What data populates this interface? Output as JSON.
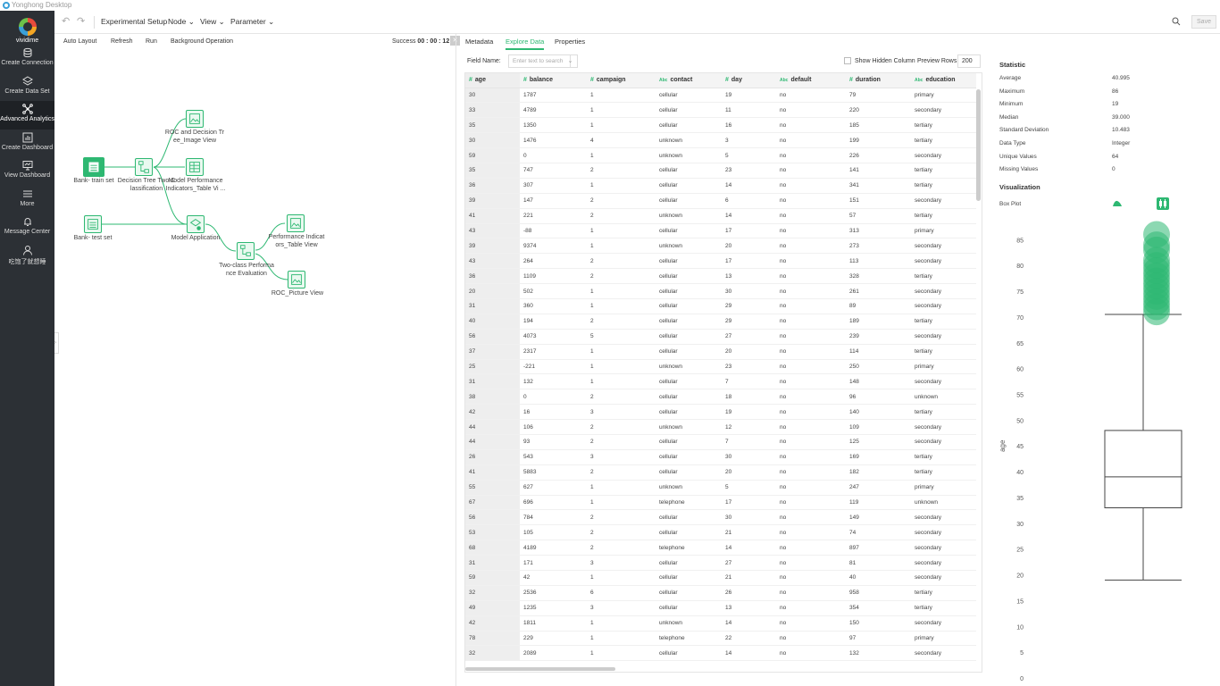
{
  "window_title": "Yonghong Desktop",
  "brand": "vividime",
  "sidebar": {
    "items": [
      {
        "label": "Create Connection",
        "icon": "database-icon"
      },
      {
        "label": "Create Data Set",
        "icon": "layers-icon"
      },
      {
        "label": "Advanced Analytics",
        "icon": "network-icon",
        "active": true
      },
      {
        "label": "Create Dashboard",
        "icon": "bar-chart-icon"
      },
      {
        "label": "View Dashboard",
        "icon": "monitor-icon"
      },
      {
        "label": "More",
        "icon": "menu-icon"
      },
      {
        "label": "Message Center",
        "icon": "bell-icon"
      },
      {
        "label": "吃饱了就想睡",
        "icon": "user-icon"
      }
    ]
  },
  "toolbar": {
    "title": "Experimental Setup",
    "node_menu": "Node",
    "view_menu": "View",
    "parameter_menu": "Parameter",
    "save_label": "Save"
  },
  "canvas_toolbar": {
    "auto_layout": "Auto Layout",
    "refresh": "Refresh",
    "run": "Run",
    "background": "Background Operation",
    "success_label": "Success",
    "success_time": "00 : 00 : 12"
  },
  "flow_nodes": {
    "train": "Bank- train set",
    "test": "Bank- test set",
    "dt_l1": "Decision Tree Two C",
    "dt_l2": "lassification",
    "roc_img_l1": "ROC and Decision Tr",
    "roc_img_l2": "ee_Image View",
    "mpi_l1": "Model Performance",
    "mpi_l2": "Indicators_Table Vi ...",
    "apply": "Model Application",
    "eval_l1": "Two-class Performa",
    "eval_l2": "nce Evaluation",
    "perf_l1": "Performance Indicat",
    "perf_l2": "ors_Table View",
    "roc_pic": "ROC_Picture View"
  },
  "tabs": {
    "metadata": "Metadata",
    "explore": "Explore Data",
    "properties": "Properties"
  },
  "filter": {
    "field_name_label": "Field Name:",
    "field_placeholder": "Enter text to search",
    "show_hidden": "Show Hidden Column",
    "preview_rows_label": "Preview Rows",
    "preview_rows": "200"
  },
  "table": {
    "columns": [
      {
        "name": "age",
        "type": "#"
      },
      {
        "name": "balance",
        "type": "#"
      },
      {
        "name": "campaign",
        "type": "#"
      },
      {
        "name": "contact",
        "type": "Abc"
      },
      {
        "name": "day",
        "type": "#"
      },
      {
        "name": "default",
        "type": "Abc"
      },
      {
        "name": "duration",
        "type": "#"
      },
      {
        "name": "education",
        "type": "Abc"
      }
    ],
    "rows": [
      [
        "30",
        "1787",
        "1",
        "cellular",
        "19",
        "no",
        "79",
        "primary"
      ],
      [
        "33",
        "4789",
        "1",
        "cellular",
        "11",
        "no",
        "220",
        "secondary"
      ],
      [
        "35",
        "1350",
        "1",
        "cellular",
        "16",
        "no",
        "185",
        "tertiary"
      ],
      [
        "30",
        "1476",
        "4",
        "unknown",
        "3",
        "no",
        "199",
        "tertiary"
      ],
      [
        "59",
        "0",
        "1",
        "unknown",
        "5",
        "no",
        "226",
        "secondary"
      ],
      [
        "35",
        "747",
        "2",
        "cellular",
        "23",
        "no",
        "141",
        "tertiary"
      ],
      [
        "36",
        "307",
        "1",
        "cellular",
        "14",
        "no",
        "341",
        "tertiary"
      ],
      [
        "39",
        "147",
        "2",
        "cellular",
        "6",
        "no",
        "151",
        "secondary"
      ],
      [
        "41",
        "221",
        "2",
        "unknown",
        "14",
        "no",
        "57",
        "tertiary"
      ],
      [
        "43",
        "-88",
        "1",
        "cellular",
        "17",
        "no",
        "313",
        "primary"
      ],
      [
        "39",
        "9374",
        "1",
        "unknown",
        "20",
        "no",
        "273",
        "secondary"
      ],
      [
        "43",
        "264",
        "2",
        "cellular",
        "17",
        "no",
        "113",
        "secondary"
      ],
      [
        "36",
        "1109",
        "2",
        "cellular",
        "13",
        "no",
        "328",
        "tertiary"
      ],
      [
        "20",
        "502",
        "1",
        "cellular",
        "30",
        "no",
        "261",
        "secondary"
      ],
      [
        "31",
        "360",
        "1",
        "cellular",
        "29",
        "no",
        "89",
        "secondary"
      ],
      [
        "40",
        "194",
        "2",
        "cellular",
        "29",
        "no",
        "189",
        "tertiary"
      ],
      [
        "56",
        "4073",
        "5",
        "cellular",
        "27",
        "no",
        "239",
        "secondary"
      ],
      [
        "37",
        "2317",
        "1",
        "cellular",
        "20",
        "no",
        "114",
        "tertiary"
      ],
      [
        "25",
        "-221",
        "1",
        "unknown",
        "23",
        "no",
        "250",
        "primary"
      ],
      [
        "31",
        "132",
        "1",
        "cellular",
        "7",
        "no",
        "148",
        "secondary"
      ],
      [
        "38",
        "0",
        "2",
        "cellular",
        "18",
        "no",
        "96",
        "unknown"
      ],
      [
        "42",
        "16",
        "3",
        "cellular",
        "19",
        "no",
        "140",
        "tertiary"
      ],
      [
        "44",
        "106",
        "2",
        "unknown",
        "12",
        "no",
        "109",
        "secondary"
      ],
      [
        "44",
        "93",
        "2",
        "cellular",
        "7",
        "no",
        "125",
        "secondary"
      ],
      [
        "26",
        "543",
        "3",
        "cellular",
        "30",
        "no",
        "169",
        "tertiary"
      ],
      [
        "41",
        "5883",
        "2",
        "cellular",
        "20",
        "no",
        "182",
        "tertiary"
      ],
      [
        "55",
        "627",
        "1",
        "unknown",
        "5",
        "no",
        "247",
        "primary"
      ],
      [
        "67",
        "696",
        "1",
        "telephone",
        "17",
        "no",
        "119",
        "unknown"
      ],
      [
        "56",
        "784",
        "2",
        "cellular",
        "30",
        "no",
        "149",
        "secondary"
      ],
      [
        "53",
        "105",
        "2",
        "cellular",
        "21",
        "no",
        "74",
        "secondary"
      ],
      [
        "68",
        "4189",
        "2",
        "telephone",
        "14",
        "no",
        "897",
        "secondary"
      ],
      [
        "31",
        "171",
        "3",
        "cellular",
        "27",
        "no",
        "81",
        "secondary"
      ],
      [
        "59",
        "42",
        "1",
        "cellular",
        "21",
        "no",
        "40",
        "secondary"
      ],
      [
        "32",
        "2536",
        "6",
        "cellular",
        "26",
        "no",
        "958",
        "tertiary"
      ],
      [
        "49",
        "1235",
        "3",
        "cellular",
        "13",
        "no",
        "354",
        "tertiary"
      ],
      [
        "42",
        "1811",
        "1",
        "unknown",
        "14",
        "no",
        "150",
        "secondary"
      ],
      [
        "78",
        "229",
        "1",
        "telephone",
        "22",
        "no",
        "97",
        "primary"
      ],
      [
        "32",
        "2089",
        "1",
        "cellular",
        "14",
        "no",
        "132",
        "secondary"
      ]
    ]
  },
  "statistic": {
    "title": "Statistic",
    "items": [
      {
        "label": "Average",
        "value": "40.995"
      },
      {
        "label": "Maximum",
        "value": "86"
      },
      {
        "label": "Minimum",
        "value": "19"
      },
      {
        "label": "Median",
        "value": "39.000"
      },
      {
        "label": "Standard Deviation",
        "value": "10.483"
      },
      {
        "label": "Data Type",
        "value": "Integer"
      },
      {
        "label": "Unique Values",
        "value": "64"
      },
      {
        "label": "Missing Values",
        "value": "0"
      }
    ]
  },
  "visualization": {
    "title": "Visualization",
    "plot_label": "Box Plot"
  },
  "chart_data": {
    "type": "box",
    "ylabel": "age",
    "ylim": [
      0,
      88
    ],
    "yticks": [
      0,
      5,
      10,
      15,
      20,
      25,
      30,
      35,
      40,
      45,
      50,
      55,
      60,
      65,
      70,
      75,
      80,
      85
    ],
    "whisker_low": 19,
    "q1": 33,
    "median": 39,
    "q3": 48,
    "whisker_high": 70.5,
    "outliers": [
      71,
      72,
      73,
      74,
      75,
      76,
      77,
      78,
      79,
      80,
      81,
      83,
      84,
      86
    ],
    "color": "#2eb872"
  }
}
